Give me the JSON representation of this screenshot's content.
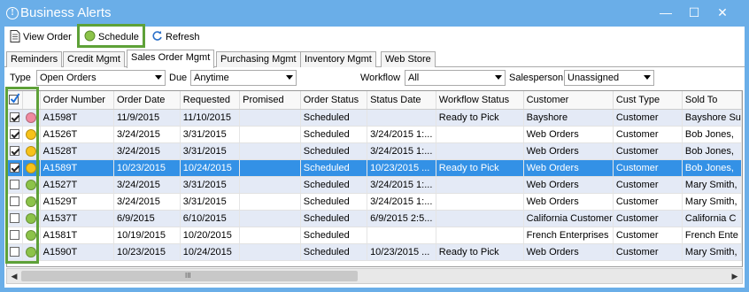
{
  "window": {
    "title": "Business Alerts",
    "controls": {
      "minimize": "—",
      "maximize": "☐",
      "close": "✕"
    }
  },
  "toolbar": {
    "view_order": "View Order",
    "schedule": "Schedule",
    "refresh": "Refresh"
  },
  "tabs": [
    {
      "label": "Reminders",
      "active": false
    },
    {
      "label": "Credit Mgmt",
      "active": false
    },
    {
      "label": "Sales Order Mgmt",
      "active": true
    },
    {
      "label": "Purchasing Mgmt",
      "active": false
    },
    {
      "label": "Inventory Mgmt",
      "active": false
    },
    {
      "label": "Web Store",
      "active": false
    }
  ],
  "filters": {
    "type_label": "Type",
    "type_value": "Open Orders",
    "due_label": "Due",
    "due_value": "Anytime",
    "workflow_label": "Workflow",
    "workflow_value": "All",
    "salesperson_label": "Salesperson",
    "salesperson_value": "Unassigned"
  },
  "colors": {
    "accent_highlight": "#5ea138",
    "selected_row": "#3391e6",
    "alt_row": "#e4eaf6",
    "dot_red": "#f08aa0",
    "dot_yellow": "#f7c21a",
    "dot_green": "#8cc34a"
  },
  "grid": {
    "columns": [
      "Order Number",
      "Order Date",
      "Requested",
      "Promised",
      "Order Status",
      "Status Date",
      "Workflow Status",
      "Customer",
      "Cust Type",
      "Sold To"
    ],
    "rows": [
      {
        "checked": true,
        "dot": "red",
        "selected": false,
        "cells": [
          "A1598T",
          "11/9/2015",
          "11/10/2015",
          "",
          "Scheduled",
          "",
          "Ready to Pick",
          "Bayshore",
          "Customer",
          "Bayshore Su"
        ]
      },
      {
        "checked": true,
        "dot": "yellow",
        "selected": false,
        "cells": [
          "A1526T",
          "3/24/2015",
          "3/31/2015",
          "",
          "Scheduled",
          "3/24/2015 1:...",
          "",
          "Web Orders",
          "Customer",
          "Bob  Jones,"
        ]
      },
      {
        "checked": true,
        "dot": "yellow",
        "selected": false,
        "cells": [
          "A1528T",
          "3/24/2015",
          "3/31/2015",
          "",
          "Scheduled",
          "3/24/2015 1:...",
          "",
          "Web Orders",
          "Customer",
          "Bob  Jones,"
        ]
      },
      {
        "checked": true,
        "dot": "yellow",
        "selected": true,
        "cells": [
          "A1589T",
          "10/23/2015",
          "10/24/2015",
          "",
          "Scheduled",
          "10/23/2015 ...",
          "Ready to Pick",
          "Web Orders",
          "Customer",
          "Bob  Jones,"
        ]
      },
      {
        "checked": false,
        "dot": "green",
        "selected": false,
        "cells": [
          "A1527T",
          "3/24/2015",
          "3/31/2015",
          "",
          "Scheduled",
          "3/24/2015 1:...",
          "",
          "Web Orders",
          "Customer",
          "Mary Smith,"
        ]
      },
      {
        "checked": false,
        "dot": "green",
        "selected": false,
        "cells": [
          "A1529T",
          "3/24/2015",
          "3/31/2015",
          "",
          "Scheduled",
          "3/24/2015 1:...",
          "",
          "Web Orders",
          "Customer",
          "Mary Smith,"
        ]
      },
      {
        "checked": false,
        "dot": "green",
        "selected": false,
        "cells": [
          "A1537T",
          "6/9/2015",
          "6/10/2015",
          "",
          "Scheduled",
          "6/9/2015 2:5...",
          "",
          "California Customer",
          "Customer",
          "California C"
        ]
      },
      {
        "checked": false,
        "dot": "green",
        "selected": false,
        "cells": [
          "A1581T",
          "10/19/2015",
          "10/20/2015",
          "",
          "Scheduled",
          "",
          "",
          "French Enterprises",
          "Customer",
          "French Ente"
        ]
      },
      {
        "checked": false,
        "dot": "green",
        "selected": false,
        "cells": [
          "A1590T",
          "10/23/2015",
          "10/24/2015",
          "",
          "Scheduled",
          "10/23/2015 ...",
          "Ready to Pick",
          "Web Orders",
          "Customer",
          "Mary Smith,"
        ]
      }
    ]
  },
  "scrollbar": {
    "left": "◀",
    "right": "▶",
    "grip": "III"
  }
}
